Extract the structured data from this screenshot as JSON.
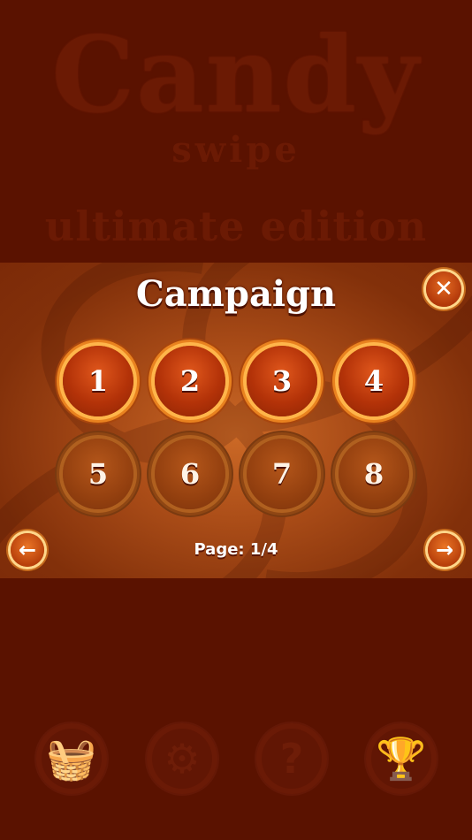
{
  "background_menu": {
    "title": "Candy",
    "subtitle": "swipe",
    "edition": "ultimate edition",
    "icons": [
      {
        "name": "shop-basket-icon",
        "glyph": "🧺"
      },
      {
        "name": "settings-gear-icon",
        "glyph": "⚙"
      },
      {
        "name": "help-question-icon",
        "glyph": "?"
      },
      {
        "name": "leaderboard-podium-icon",
        "glyph": "🏆"
      }
    ]
  },
  "campaign": {
    "title": "Campaign",
    "close_glyph": "✕",
    "levels": [
      {
        "label": "1",
        "state": "unlocked"
      },
      {
        "label": "2",
        "state": "unlocked"
      },
      {
        "label": "3",
        "state": "unlocked"
      },
      {
        "label": "4",
        "state": "unlocked"
      },
      {
        "label": "5",
        "state": "locked"
      },
      {
        "label": "6",
        "state": "locked"
      },
      {
        "label": "7",
        "state": "locked"
      },
      {
        "label": "8",
        "state": "locked"
      }
    ],
    "page_text": "Page: 1/4",
    "prev_glyph": "←",
    "next_glyph": "→"
  },
  "colors": {
    "backdrop": "#5a1200",
    "panel_center": "#d26e28",
    "button_ring": "#ffb54a",
    "text": "#ffffff"
  }
}
